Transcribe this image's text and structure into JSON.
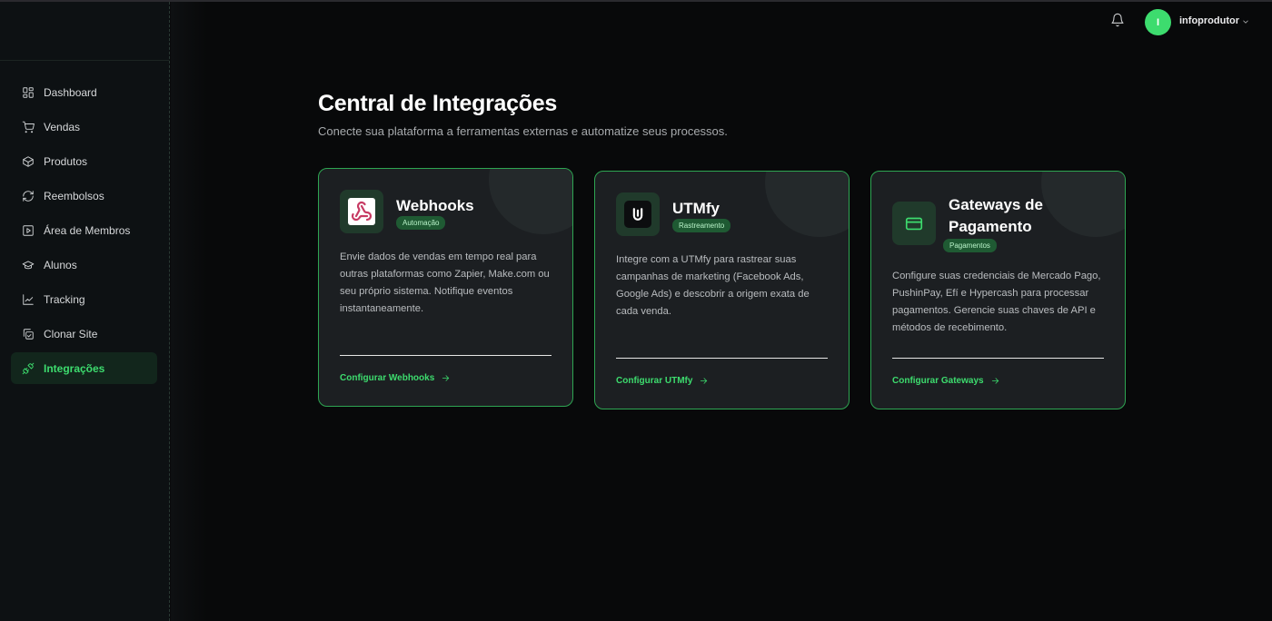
{
  "sidebar": {
    "items": [
      {
        "label": "Dashboard",
        "icon": "dashboard-icon"
      },
      {
        "label": "Vendas",
        "icon": "cart-icon"
      },
      {
        "label": "Produtos",
        "icon": "package-icon"
      },
      {
        "label": "Reembolsos",
        "icon": "refresh-icon"
      },
      {
        "label": "Área de Membros",
        "icon": "play-square-icon"
      },
      {
        "label": "Alunos",
        "icon": "graduation-cap-icon"
      },
      {
        "label": "Tracking",
        "icon": "chart-line-icon"
      },
      {
        "label": "Clonar Site",
        "icon": "copy-check-icon"
      },
      {
        "label": "Integrações",
        "icon": "plug-icon",
        "active": true
      }
    ]
  },
  "header": {
    "avatar_initial": "I",
    "username": "infoprodutor"
  },
  "page": {
    "title": "Central de Integrações",
    "subtitle": "Conecte sua plataforma a ferramentas externas e automatize seus processos."
  },
  "cards": [
    {
      "title": "Webhooks",
      "badge": "Automação",
      "description": "Envie dados de vendas em tempo real para outras plataformas como Zapier, Make.com ou seu próprio sistema. Notifique eventos instantaneamente.",
      "action": "Configurar Webhooks",
      "icon": "webhook-icon"
    },
    {
      "title": "UTMfy",
      "badge": "Rastreamento",
      "description": "Integre com a UTMfy para rastrear suas campanhas de marketing (Facebook Ads, Google Ads) e descobrir a origem exata de cada venda.",
      "action": "Configurar UTMfy",
      "icon": "utmfy-logo-icon"
    },
    {
      "title": "Gateways de Pagamento",
      "badge": "Pagamentos",
      "description": "Configure suas credenciais de Mercado Pago, PushinPay, Efí e Hypercash para processar pagamentos. Gerencie suas chaves de API e métodos de recebimento.",
      "action": "Configurar Gateways",
      "icon": "credit-card-icon"
    }
  ],
  "colors": {
    "accent": "#3ddc6e",
    "background": "#08090a",
    "sidebar": "#0d1113",
    "card": "#1c1f22",
    "card_border": "#2ea552",
    "badge": "#1f5a33"
  }
}
